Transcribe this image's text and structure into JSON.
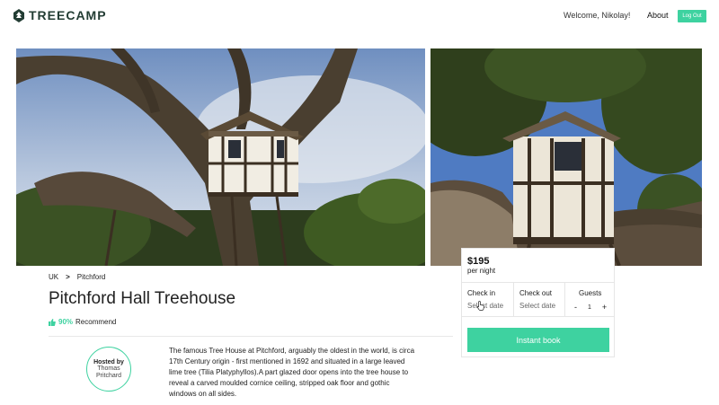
{
  "header": {
    "brand": "TREECAMP",
    "welcome": "Welcome, Nikolay!",
    "about": "About",
    "logout": "Log Out"
  },
  "breadcrumb": {
    "country": "UK",
    "separator": ">",
    "place": "Pitchford"
  },
  "listing": {
    "title": "Pitchford Hall Treehouse",
    "recommend_pct": "90%",
    "recommend_label": "Recommend",
    "description": "The famous Tree House at Pitchford, arguably the oldest in the world, is circa 17th Century origin - first mentioned in 1692 and situated in a large leaved lime tree (Tilia Platyphyllos).A part glazed door opens into the tree house to reveal a carved moulded cornice ceiling, stripped oak floor and gothic windows on all sides."
  },
  "host": {
    "label": "Hosted by",
    "name": "Thomas Pritchard"
  },
  "booking": {
    "price": "$195",
    "per": "per night",
    "check_in_label": "Check in",
    "check_in_value": "Select date",
    "check_out_label": "Check out",
    "check_out_value": "Select date",
    "guests_label": "Guests",
    "minus": "-",
    "guests_count": "1",
    "plus": "+",
    "cta": "Instant book"
  },
  "colors": {
    "accent": "#3ed2a0",
    "brand": "#233d34"
  },
  "icons": {
    "logo": "tree-leaf-icon",
    "recommend": "thumbs-up-icon",
    "cursor": "pointer-cursor-icon"
  }
}
